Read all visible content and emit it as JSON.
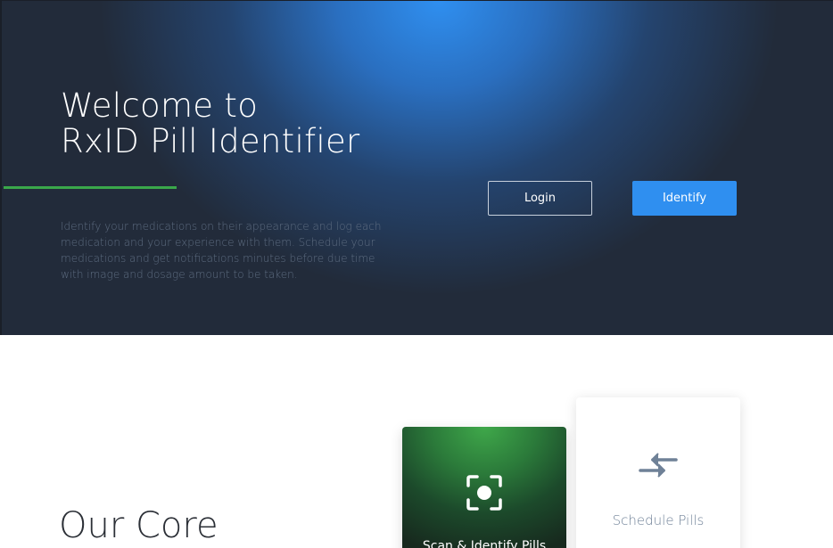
{
  "hero": {
    "title_line1": "Welcome to",
    "title_line2": "RxID Pill Identifier",
    "description": "Identify your medications on their appearance and log each medication and your experience with them. Schedule your medications and get notifications minutes before due time with image and dosage amount to be taken.",
    "login_label": "Login",
    "identify_label": "Identify"
  },
  "core": {
    "title": "Our Core",
    "cards": [
      {
        "label": "Scan & Identify Pills",
        "icon": "scan-focus-icon"
      },
      {
        "label": "Schedule Pills",
        "icon": "arrows-exchange-icon"
      }
    ]
  },
  "colors": {
    "accent_blue": "#2f8ff0",
    "accent_green": "#3aa84a",
    "hero_dark": "#222b3a"
  }
}
